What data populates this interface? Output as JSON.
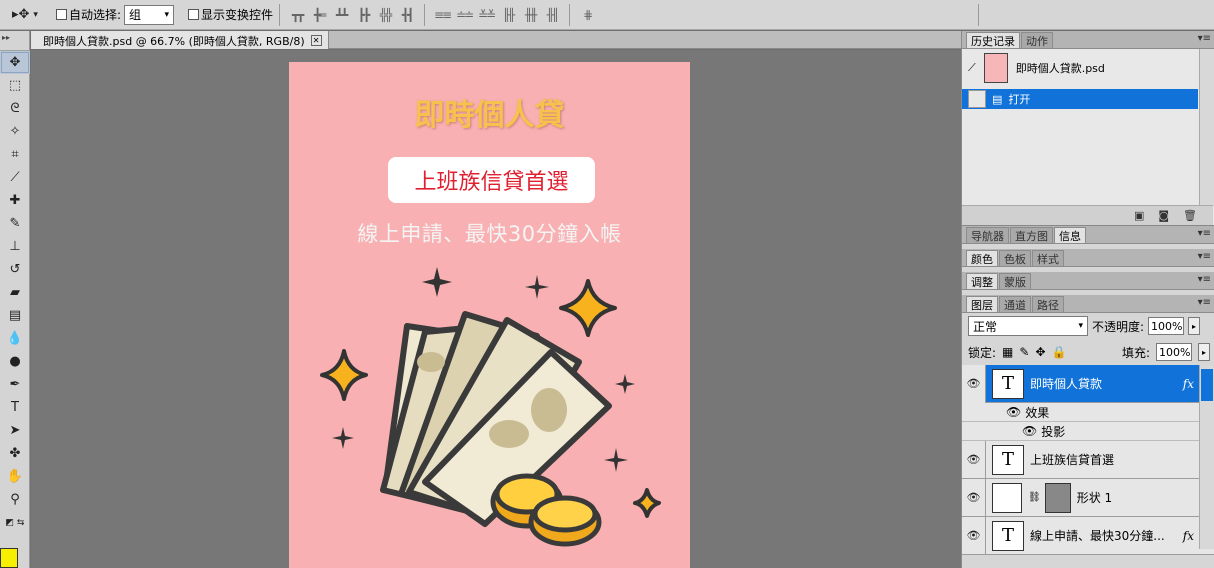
{
  "optbar": {
    "auto_select_label": "自动选择:",
    "auto_select_value": "组",
    "show_transform_label": "显示变换控件"
  },
  "document": {
    "tab_title": "即時個人貸款.psd @ 66.7% (即時個人貸款, RGB/8)",
    "canvas": {
      "title": "即時個人貸",
      "button_text": "上班族信貸首選",
      "subtitle": "線上申請、最快30分鐘入帳"
    }
  },
  "colors": {
    "canvas_bg": "#f9b0b2",
    "title_color": "#f6c24d",
    "button_text_color": "#e02030",
    "selection_blue": "#1173d9",
    "foreground_color": "#f6f000"
  },
  "history_panel": {
    "tabs": [
      "历史记录",
      "动作"
    ],
    "snapshot_name": "即時個人貸款.psd",
    "step_name": "打开"
  },
  "panel_groups": {
    "group1": [
      "导航器",
      "直方图",
      "信息"
    ],
    "group2": [
      "颜色",
      "色板",
      "样式"
    ],
    "group3": [
      "调整",
      "蒙版"
    ],
    "group4": [
      "图层",
      "通道",
      "路径"
    ]
  },
  "layers_panel": {
    "blend_mode": "正常",
    "opacity_label": "不透明度:",
    "opacity_value": "100%",
    "lock_label": "锁定:",
    "fill_label": "填充:",
    "fill_value": "100%",
    "layers": [
      {
        "name": "即時個人貸款",
        "type": "text",
        "fx": "fx"
      },
      {
        "name": "上班族信貸首選",
        "type": "text"
      },
      {
        "name": "形状 1",
        "type": "shape"
      },
      {
        "name": "線上申請、最快30分鐘...",
        "type": "text",
        "fx": "fx"
      }
    ],
    "effects_label": "效果",
    "drop_shadow_label": "投影"
  }
}
